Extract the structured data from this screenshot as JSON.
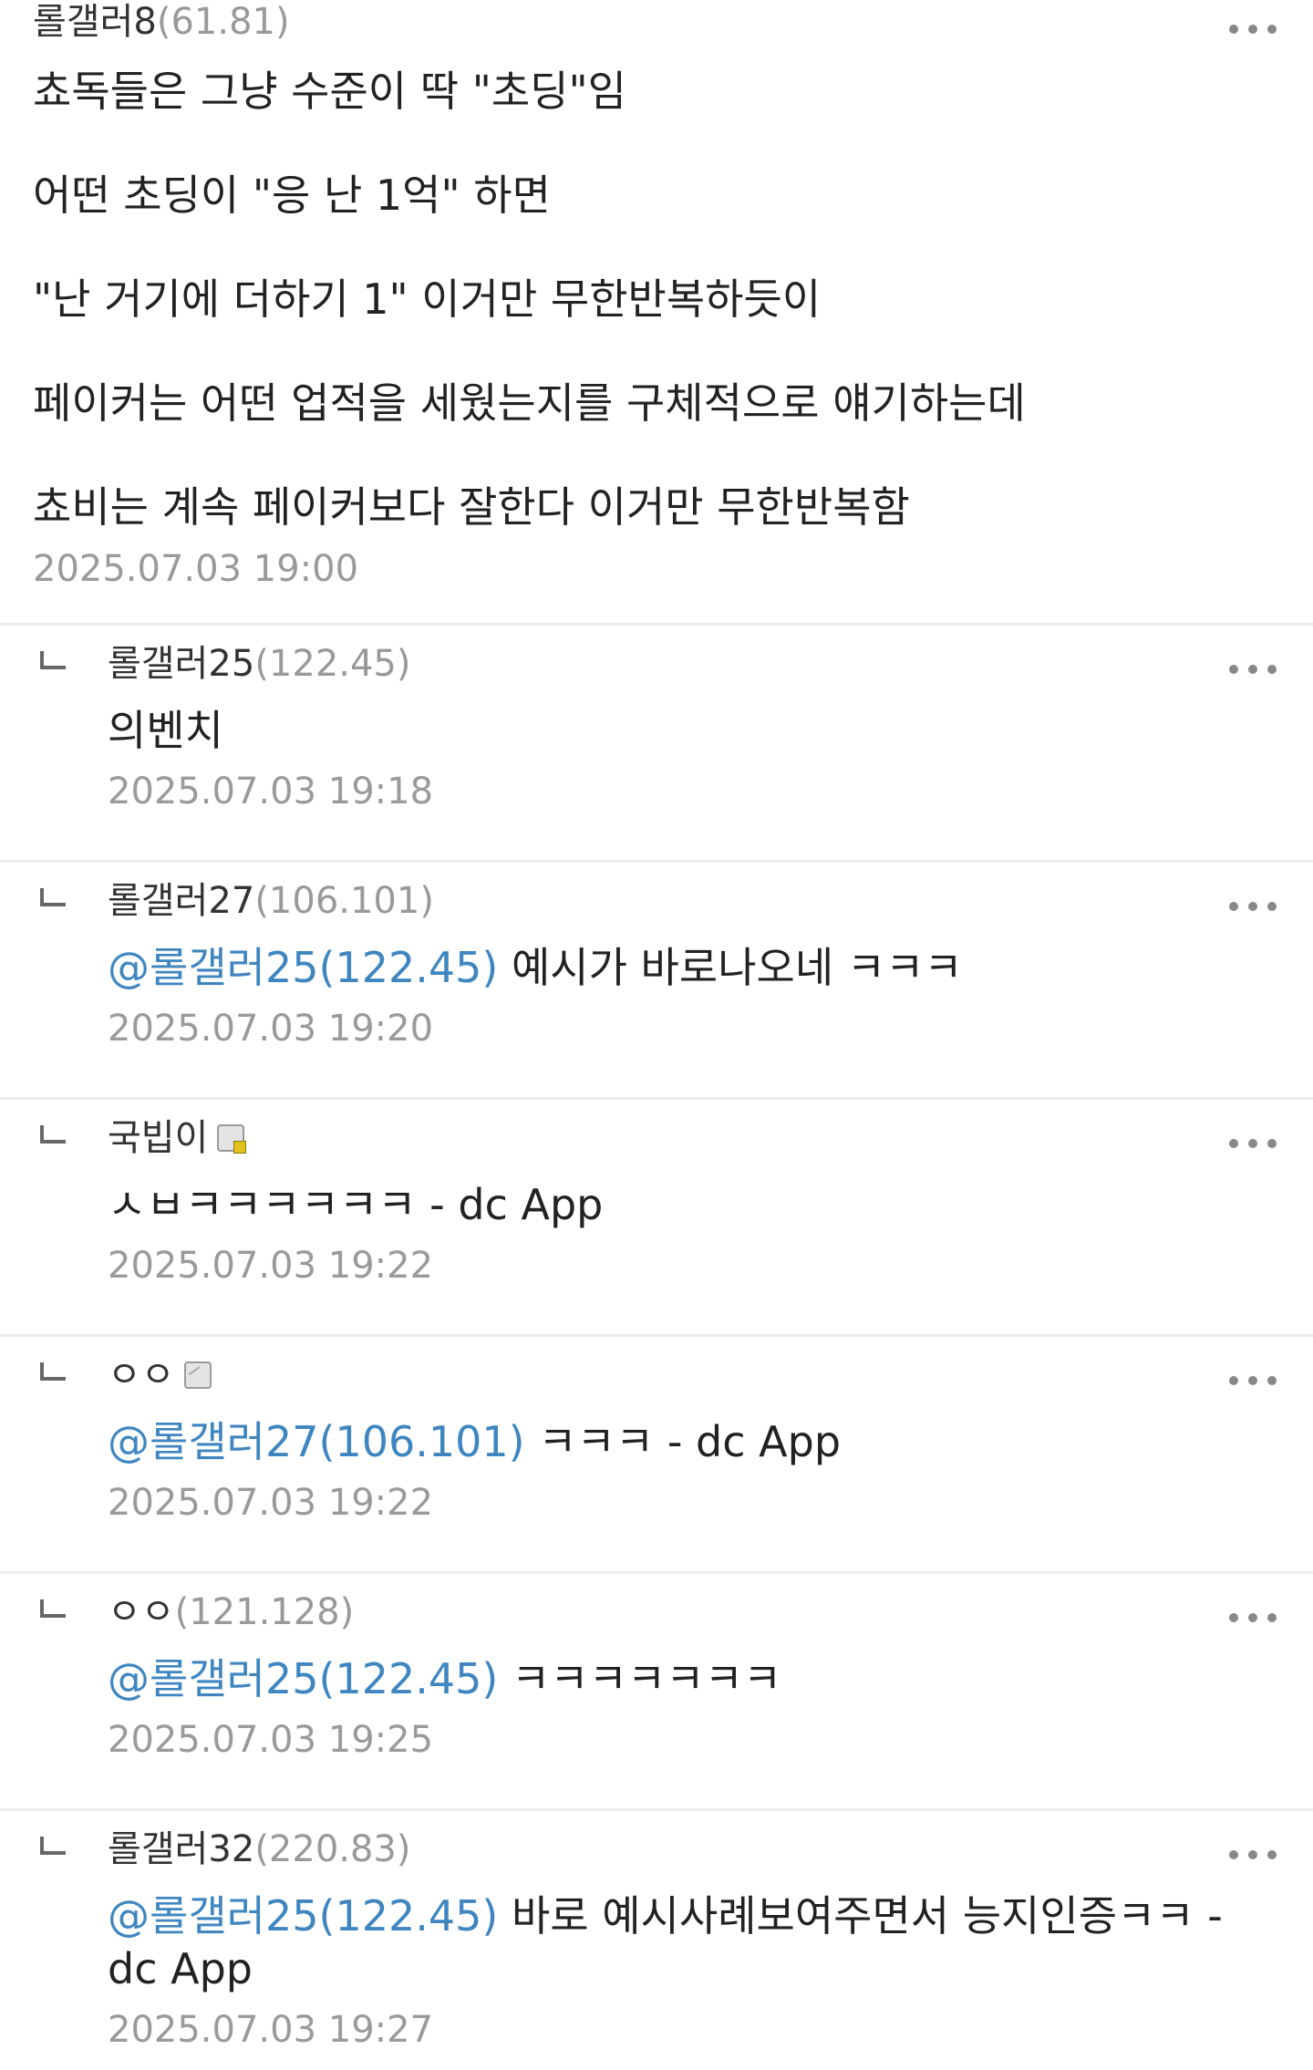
{
  "main_comment": {
    "nick": "롤갤러8",
    "ip": "(61.81)",
    "lines": [
      "쵸독들은 그냥 수준이 딱 \"초딩\"임",
      "어떤 초딩이 \"응 난 1억\" 하면",
      "\"난 거기에 더하기 1\" 이거만 무한반복하듯이",
      "페이커는 어떤 업적을 세웠는지를 구체적으로 얘기하는데",
      "쵸비는 계속 페이커보다 잘한다 이거만 무한반복함"
    ],
    "date": "2025.07.03 19:00"
  },
  "replies": [
    {
      "nick": "롤갤러25",
      "ip": "(122.45)",
      "badge": "",
      "mention": "",
      "text": "의벤치",
      "date": "2025.07.03 19:18"
    },
    {
      "nick": "롤갤러27",
      "ip": "(106.101)",
      "badge": "",
      "mention": "@롤갤러25(122.45)",
      "text": " 예시가 바로나오네 ㅋㅋㅋ",
      "date": "2025.07.03 19:20"
    },
    {
      "nick": "국빕이",
      "ip": "",
      "badge": "gold",
      "mention": "",
      "text": "ㅅㅂㅋㅋㅋㅋㅋㅋ - dc App",
      "date": "2025.07.03 19:22"
    },
    {
      "nick": "ㅇㅇ",
      "ip": "",
      "badge": "plain",
      "mention": "@롤갤러27(106.101)",
      "text": " ㅋㅋㅋ - dc App",
      "date": "2025.07.03 19:22"
    },
    {
      "nick": "ㅇㅇ",
      "ip": "(121.128)",
      "badge": "",
      "mention": "@롤갤러25(122.45)",
      "text": " ㅋㅋㅋㅋㅋㅋㅋ",
      "date": "2025.07.03 19:25"
    },
    {
      "nick": "롤갤러32",
      "ip": "(220.83)",
      "badge": "",
      "mention": "@롤갤러25(122.45)",
      "text": " 바로 예시사례보여주면서 능지인증ㅋㅋ - dc App",
      "date": "2025.07.03 19:27"
    }
  ],
  "icons": {
    "reply_arrow": "reply-arrow-icon",
    "more": "more-options-icon"
  },
  "colors": {
    "mention": "#3f86c0",
    "meta_gray": "#999999",
    "text": "#222222",
    "divider": "#ececec"
  }
}
